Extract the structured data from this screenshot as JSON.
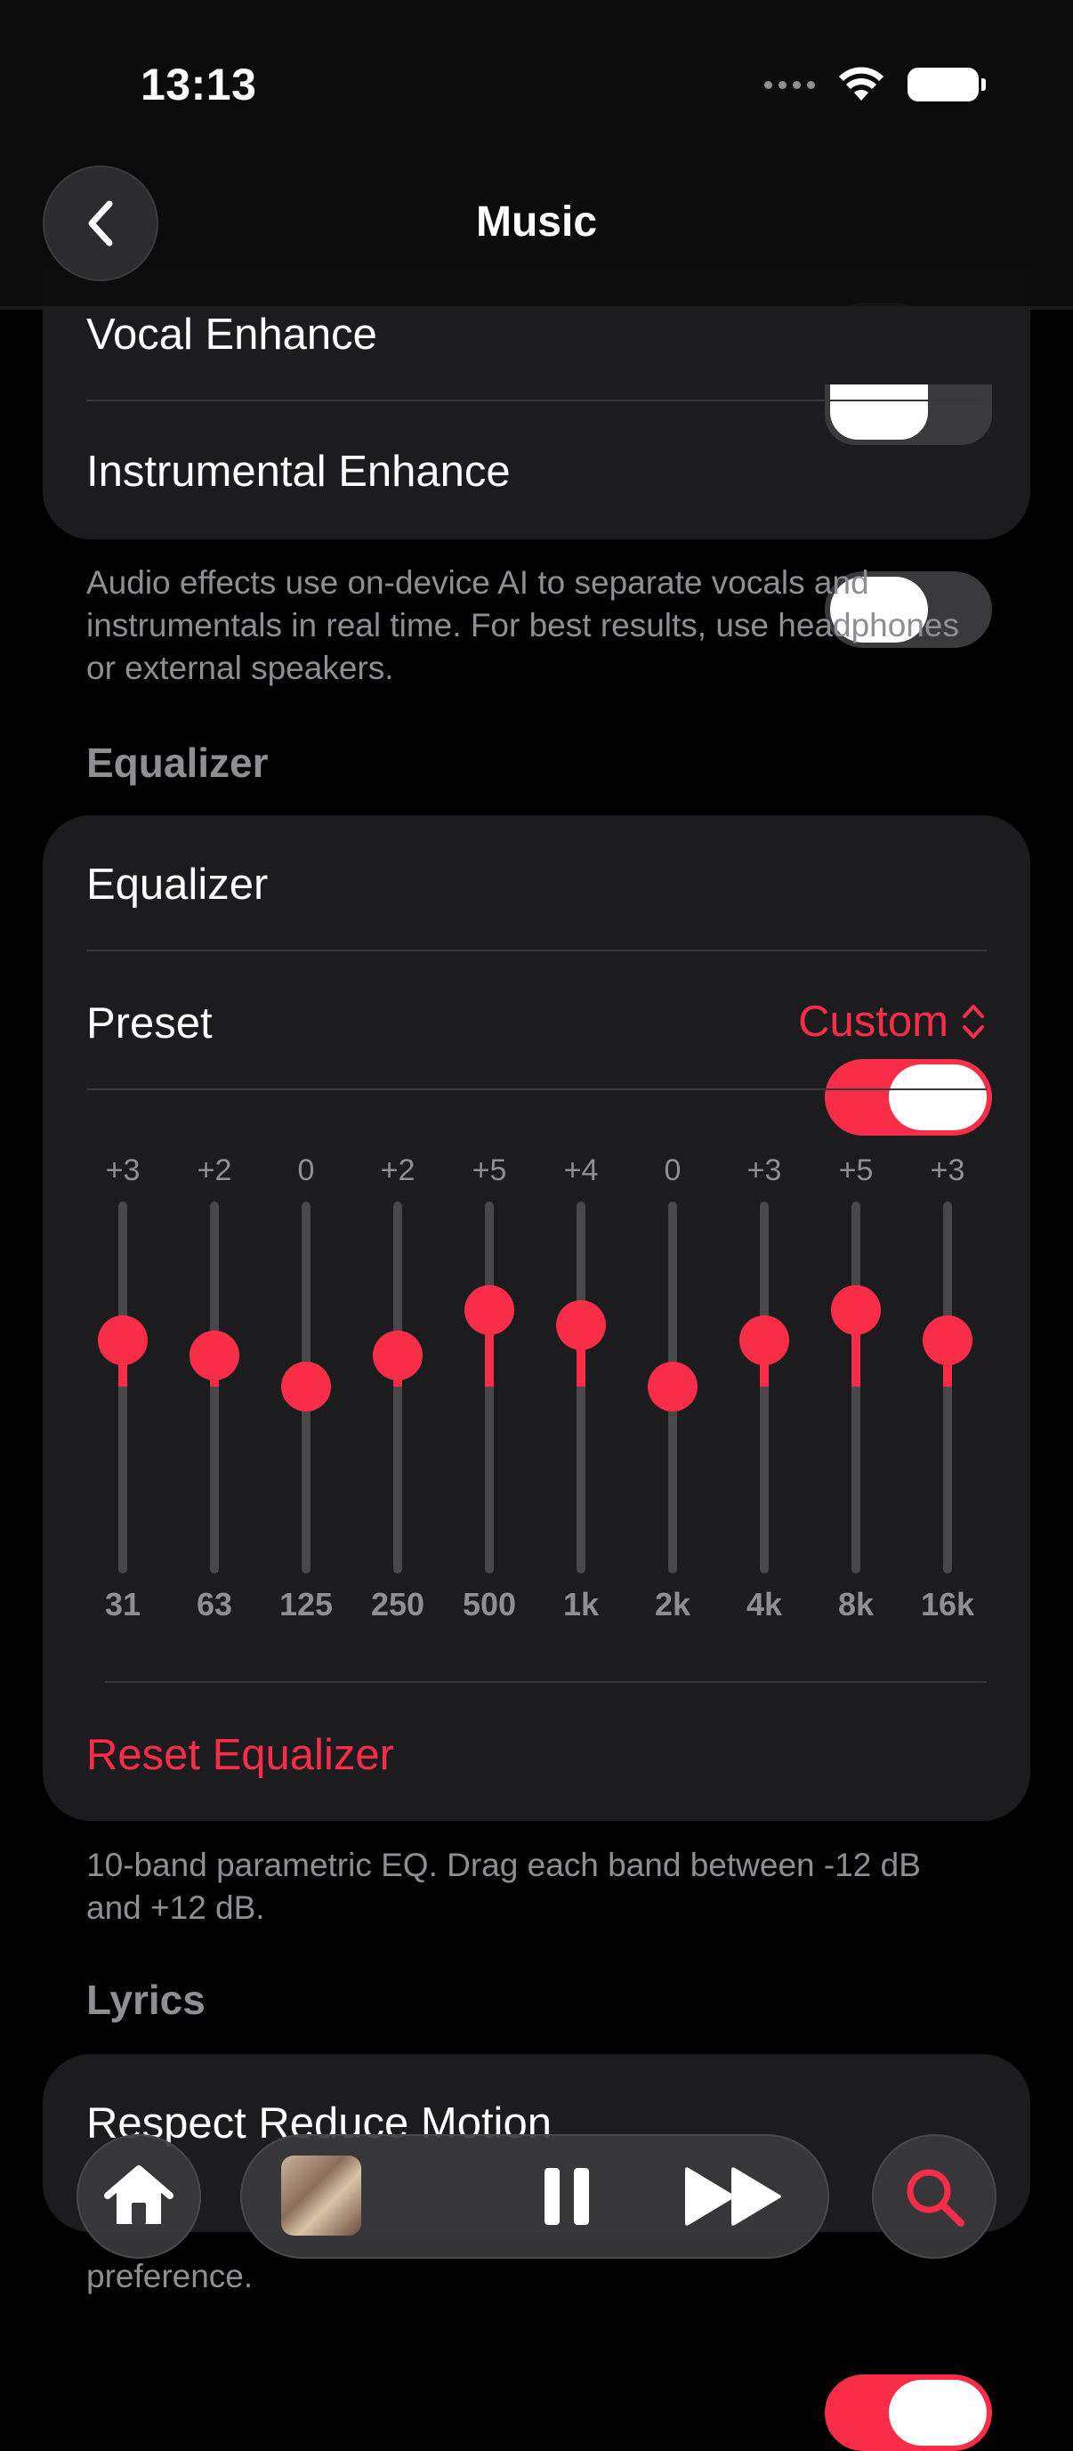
{
  "status_bar": {
    "time": "13:13"
  },
  "header": {
    "title": "Music"
  },
  "audio_effects": {
    "vocal_enhance": {
      "label": "Vocal Enhance",
      "on": false
    },
    "instrumental_enhance": {
      "label": "Instrumental Enhance",
      "on": false
    },
    "footnote": "Audio effects use on-device AI to separate vocals and instrumentals in real time. For best results, use headphones or external speakers."
  },
  "equalizer_section": {
    "header": "Equalizer",
    "toggle_label": "Equalizer",
    "toggle_on": true,
    "preset_label": "Preset",
    "preset_value": "Custom",
    "bands": [
      {
        "freq": "31",
        "label": "+3",
        "db": 3
      },
      {
        "freq": "63",
        "label": "+2",
        "db": 2
      },
      {
        "freq": "125",
        "label": "0",
        "db": 0
      },
      {
        "freq": "250",
        "label": "+2",
        "db": 2
      },
      {
        "freq": "500",
        "label": "+5",
        "db": 5
      },
      {
        "freq": "1k",
        "label": "+4",
        "db": 4
      },
      {
        "freq": "2k",
        "label": "0",
        "db": 0
      },
      {
        "freq": "4k",
        "label": "+3",
        "db": 3
      },
      {
        "freq": "8k",
        "label": "+5",
        "db": 5
      },
      {
        "freq": "16k",
        "label": "+3",
        "db": 3
      }
    ],
    "db_range": [
      -12,
      12
    ],
    "reset_label": "Reset Equalizer",
    "footnote": "10-band parametric EQ. Drag each band between -12 dB and +12 dB."
  },
  "lyrics_section": {
    "header": "Lyrics",
    "respect_reduce_motion_label": "Respect Reduce Motion",
    "respect_reduce_motion_on": true,
    "footnote_visible": "preference."
  },
  "colors": {
    "accent": "#fa2d48",
    "card": "#1c1c1e",
    "secondary_text": "#8e8e93"
  }
}
